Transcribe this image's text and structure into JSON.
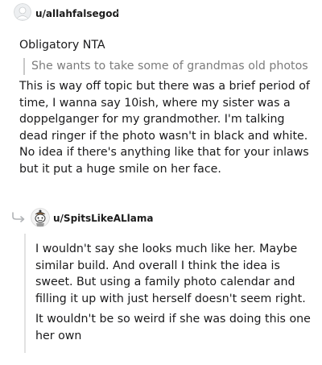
{
  "comment1": {
    "username": "u/allahfalsegod",
    "separator": "•",
    "line1": "Obligatory NTA",
    "quote": "She wants to take some of grandmas old photos",
    "body_lines": [
      "This is way off topic but there was a brief period of",
      "time, I wanna say 10ish, where my sister was a",
      "doppelganger for my grandmother. I'm talking",
      "dead ringer if the photo wasn't in black and white.",
      "No idea if there's anything like that for your inlaws",
      "but it put a huge smile on her face."
    ]
  },
  "comment2": {
    "username": "u/SpitsLikeALlama",
    "separator": "•",
    "para1_lines": [
      "I wouldn't say she looks much like her. Maybe",
      "similar build. And overall I think the idea is",
      "sweet. But using a family photo calendar and",
      "filling it up with just herself doesn't seem right."
    ],
    "para2_lines": [
      "It wouldn't be so weird if she was doing this one",
      "her own"
    ]
  },
  "icons": {
    "avatar1": "default-avatar-icon",
    "avatar2": "snoo-avatar-icon",
    "reply": "reply-arrow-icon"
  }
}
